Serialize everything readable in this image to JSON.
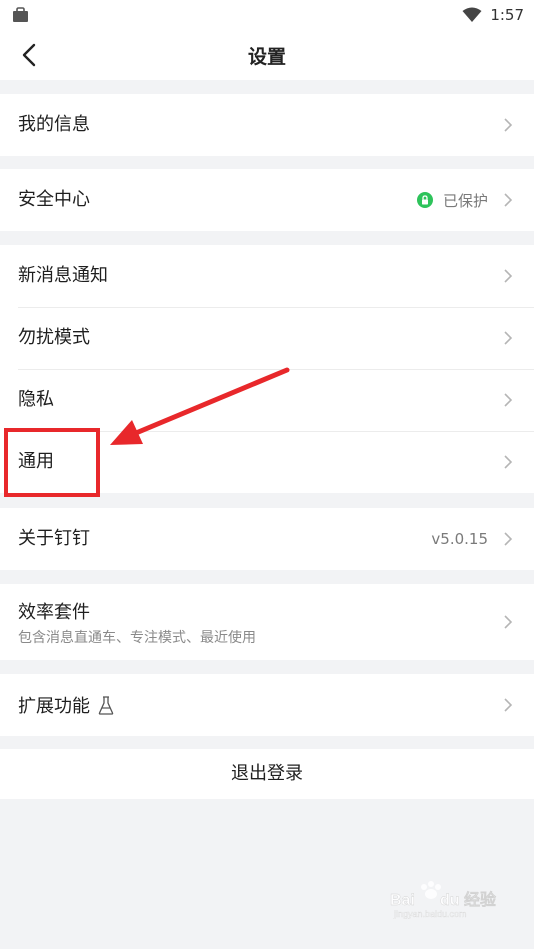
{
  "status_bar": {
    "time": "1:57"
  },
  "header": {
    "title": "设置"
  },
  "groups": {
    "info": {
      "label": "我的信息"
    },
    "security": {
      "label": "安全中心",
      "status": "已保护"
    },
    "notify": {
      "label": "新消息通知"
    },
    "dnd": {
      "label": "勿扰模式"
    },
    "privacy": {
      "label": "隐私"
    },
    "general": {
      "label": "通用"
    },
    "about": {
      "label": "关于钉钉",
      "version": "v5.0.15"
    },
    "efficiency": {
      "label": "效率套件",
      "sub": "包含消息直通车、专注模式、最近使用"
    },
    "extensions": {
      "label": "扩展功能"
    }
  },
  "logout": {
    "label": "退出登录"
  },
  "watermark": {
    "brand": "Bai du 经验",
    "url": "jingyan.baidu.com"
  },
  "colors": {
    "accent_green": "#2ec35b",
    "annotation_red": "#e8282b"
  }
}
